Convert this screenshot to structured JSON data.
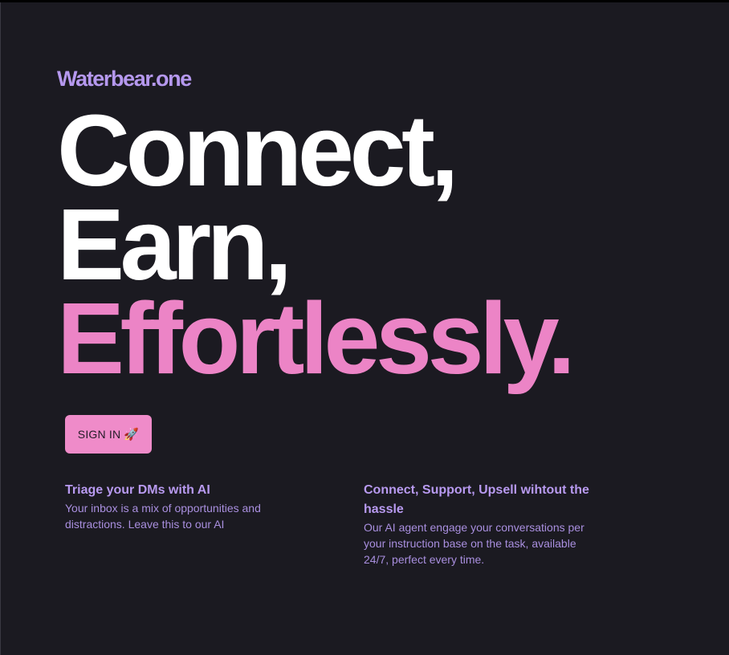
{
  "brand": {
    "name": "Waterbear.one"
  },
  "hero": {
    "line1": "Connect,",
    "line2": "Earn,",
    "line3": "Effortlessly."
  },
  "cta": {
    "label": "SIGN IN",
    "icon": "🚀"
  },
  "features": [
    {
      "title": "Triage your DMs with AI",
      "description": "Your inbox is a mix of opportunities and distractions. Leave this to our AI"
    },
    {
      "title": "Connect, Support, Upsell wihtout the hassle",
      "description": "Our AI agent engage your conversations per your instruction base on the task, available 24/7, perfect every time."
    }
  ],
  "colors": {
    "background": "#1b1a21",
    "brand": "#b598ee",
    "accent_pink": "#ec84c6",
    "headline_white": "#ffffff",
    "button": "#ef8bc9"
  }
}
